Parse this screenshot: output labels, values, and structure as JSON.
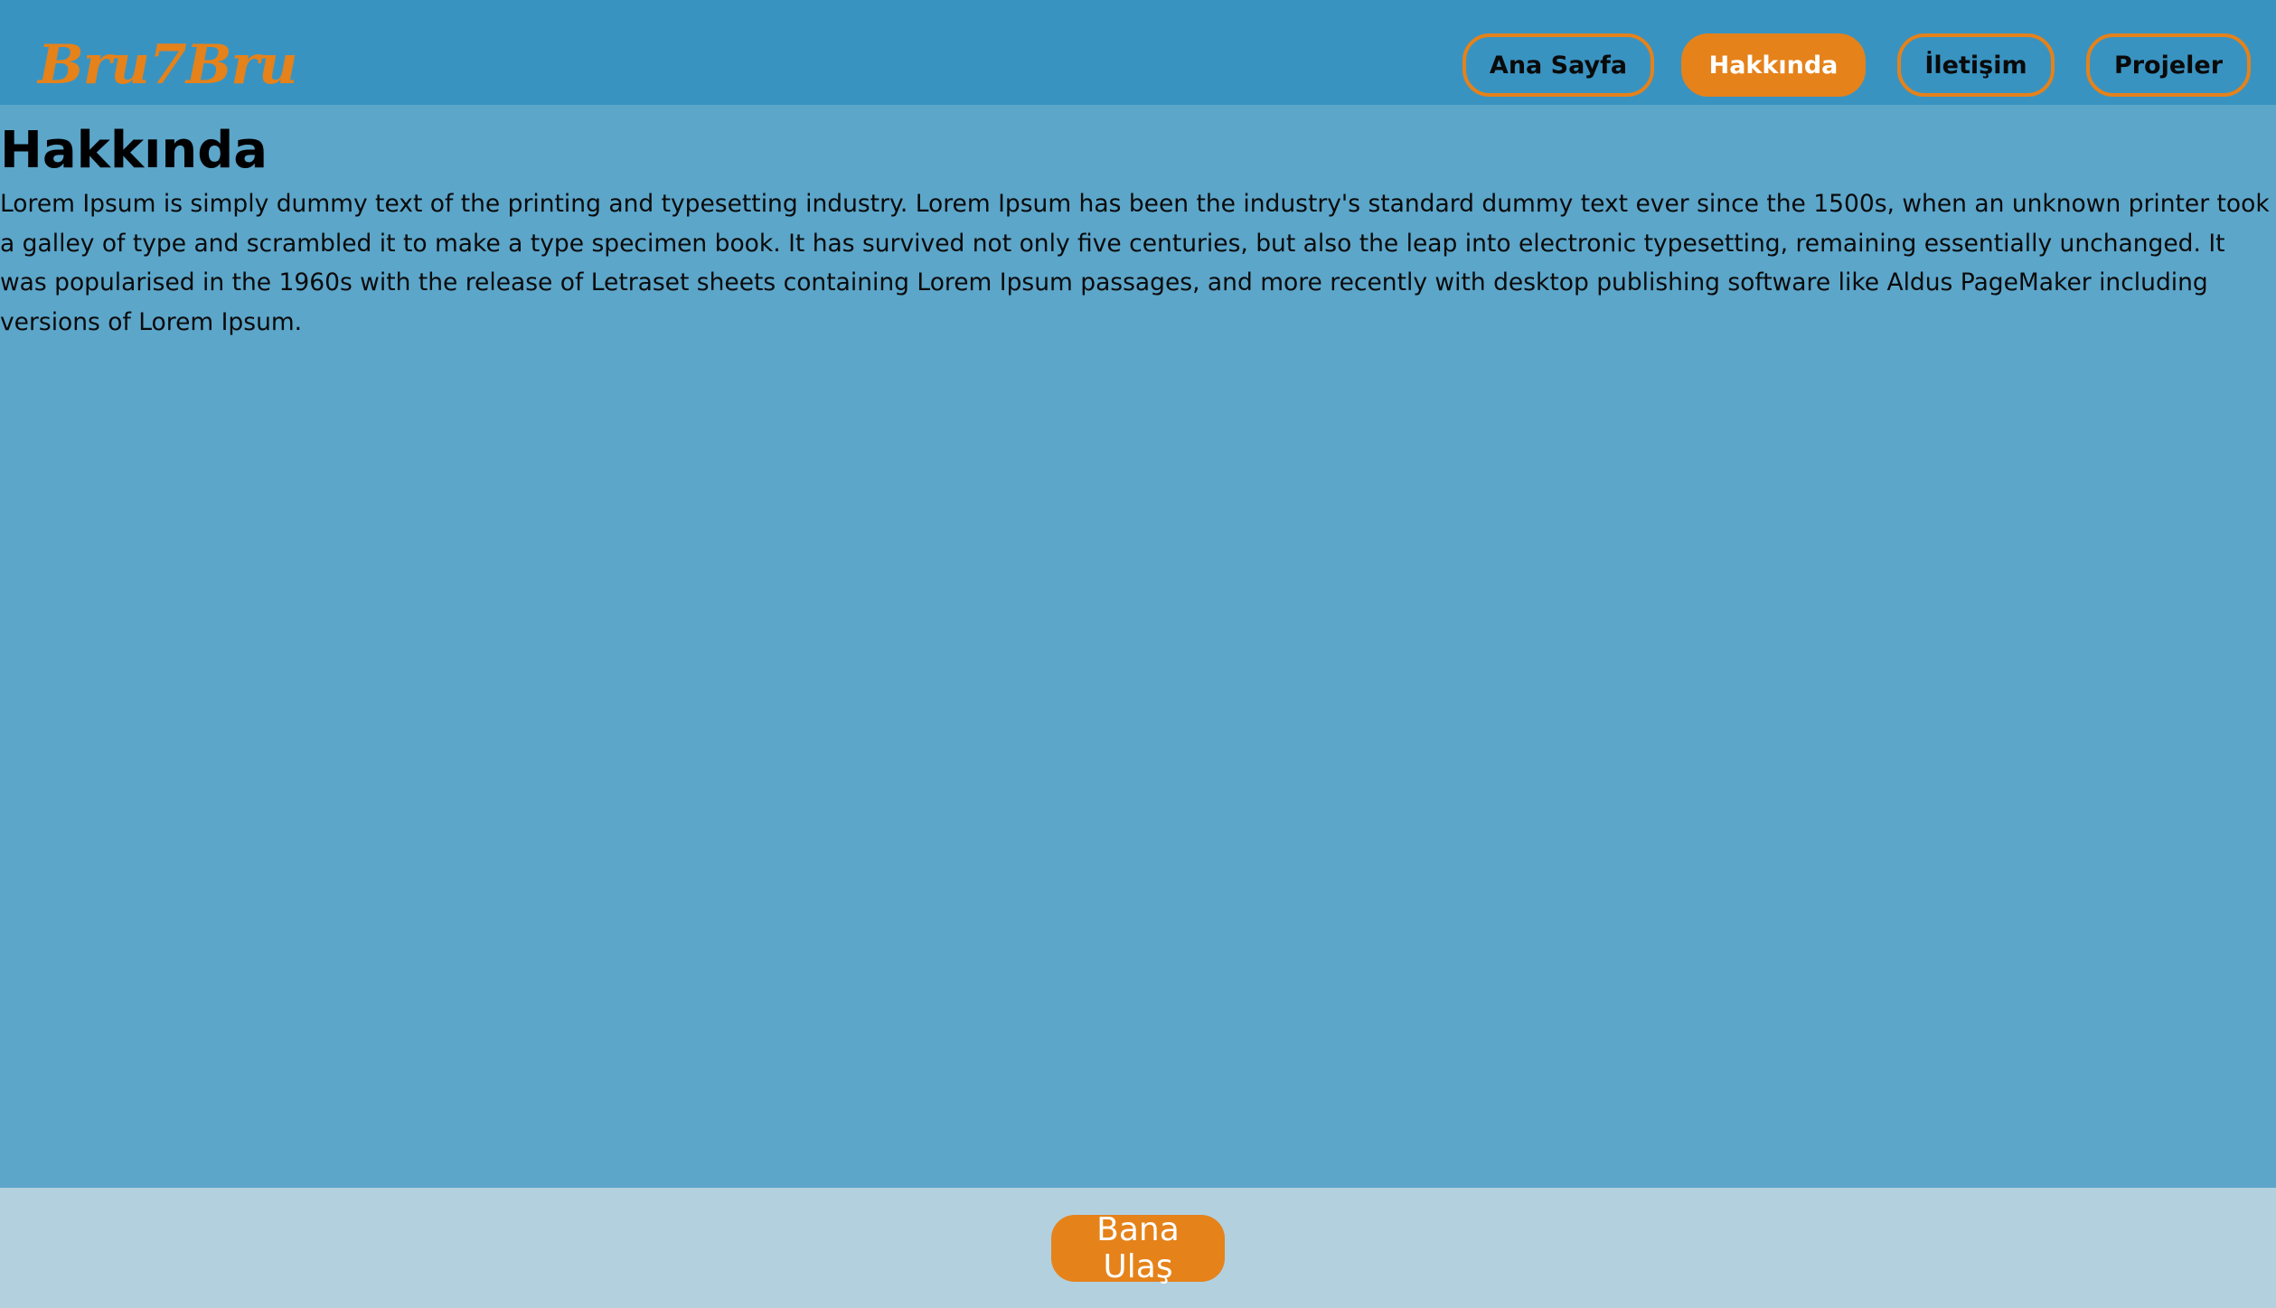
{
  "header": {
    "logo_text": "Bru7Bru",
    "nav": [
      {
        "label": "Ana Sayfa",
        "active": false
      },
      {
        "label": "Hakkında",
        "active": true
      },
      {
        "label": "İletişim",
        "active": false
      },
      {
        "label": "Projeler",
        "active": false
      }
    ]
  },
  "main": {
    "title": "Hakkında",
    "paragraph": "Lorem Ipsum is simply dummy text of the printing and typesetting industry. Lorem Ipsum has been the industry's standard dummy text ever since the 1500s, when an unknown printer took a galley of type and scrambled it to make a type specimen book. It has survived not only five centuries, but also the leap into electronic typesetting, remaining essentially unchanged. It was popularised in the 1960s with the release of Letraset sheets containing Lorem Ipsum passages, and more recently with desktop publishing software like Aldus PageMaker including versions of Lorem Ipsum."
  },
  "footer": {
    "cta_label": "Bana Ulaş"
  },
  "colors": {
    "header_bg": "#3993c1",
    "page_bg": "#5ca6ca",
    "footer_bg": "#b3d0df",
    "accent": "#e5821a"
  }
}
